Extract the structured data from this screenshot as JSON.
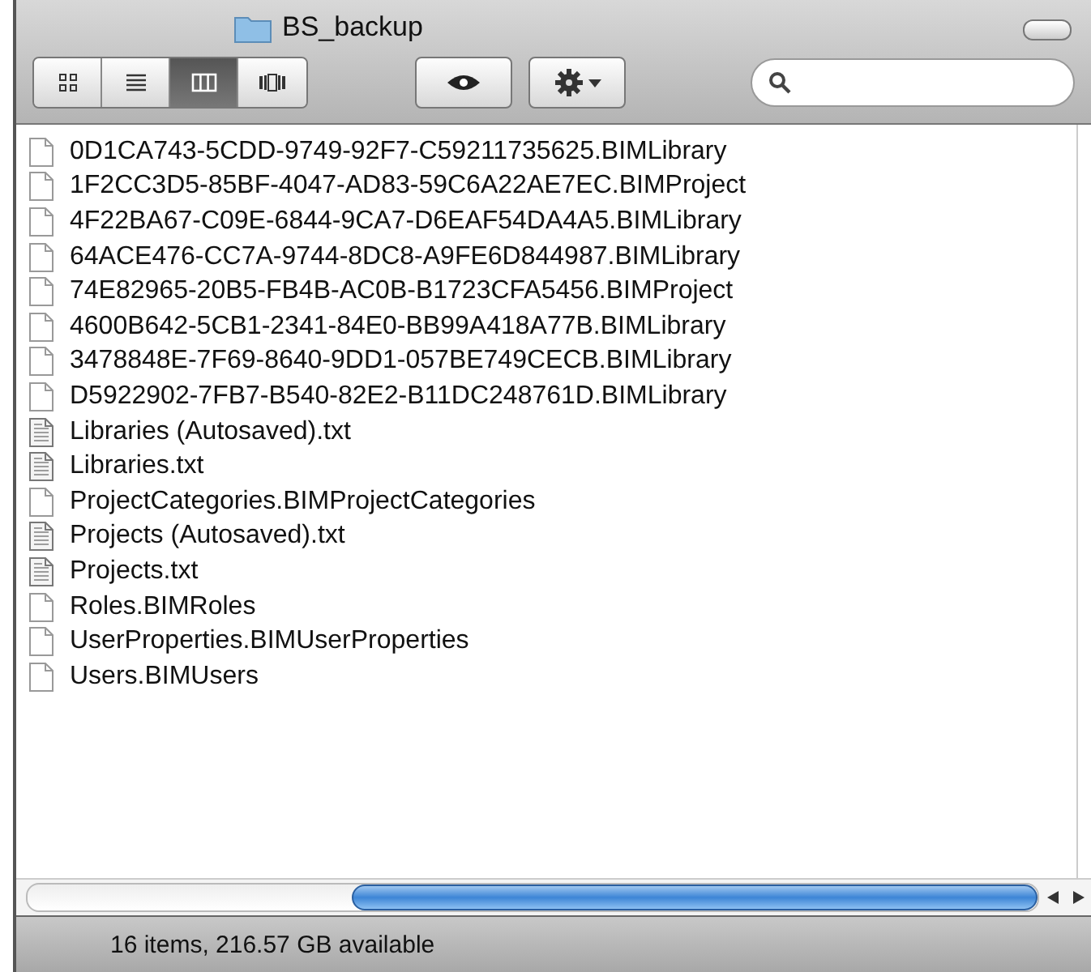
{
  "window": {
    "title": "BS_backup"
  },
  "view_modes": [
    {
      "kind": "icons",
      "selected": false
    },
    {
      "kind": "list",
      "selected": false
    },
    {
      "kind": "columns",
      "selected": true
    },
    {
      "kind": "coverflow",
      "selected": false
    }
  ],
  "files": [
    {
      "name": "0D1CA743-5CDD-9749-92F7-C59211735625.BIMLibrary",
      "kind": "document"
    },
    {
      "name": "1F2CC3D5-85BF-4047-AD83-59C6A22AE7EC.BIMProject",
      "kind": "document"
    },
    {
      "name": "4F22BA67-C09E-6844-9CA7-D6EAF54DA4A5.BIMLibrary",
      "kind": "document"
    },
    {
      "name": "64ACE476-CC7A-9744-8DC8-A9FE6D844987.BIMLibrary",
      "kind": "document"
    },
    {
      "name": "74E82965-20B5-FB4B-AC0B-B1723CFA5456.BIMProject",
      "kind": "document"
    },
    {
      "name": "4600B642-5CB1-2341-84E0-BB99A418A77B.BIMLibrary",
      "kind": "document"
    },
    {
      "name": "3478848E-7F69-8640-9DD1-057BE749CECB.BIMLibrary",
      "kind": "document"
    },
    {
      "name": "D5922902-7FB7-B540-82E2-B11DC248761D.BIMLibrary",
      "kind": "document"
    },
    {
      "name": "Libraries (Autosaved).txt",
      "kind": "text"
    },
    {
      "name": "Libraries.txt",
      "kind": "text"
    },
    {
      "name": "ProjectCategories.BIMProjectCategories",
      "kind": "document"
    },
    {
      "name": "Projects (Autosaved).txt",
      "kind": "text"
    },
    {
      "name": "Projects.txt",
      "kind": "text"
    },
    {
      "name": "Roles.BIMRoles",
      "kind": "document"
    },
    {
      "name": "UserProperties.BIMUserProperties",
      "kind": "document"
    },
    {
      "name": "Users.BIMUsers",
      "kind": "document"
    }
  ],
  "status_bar": "16 items, 216.57 GB available"
}
